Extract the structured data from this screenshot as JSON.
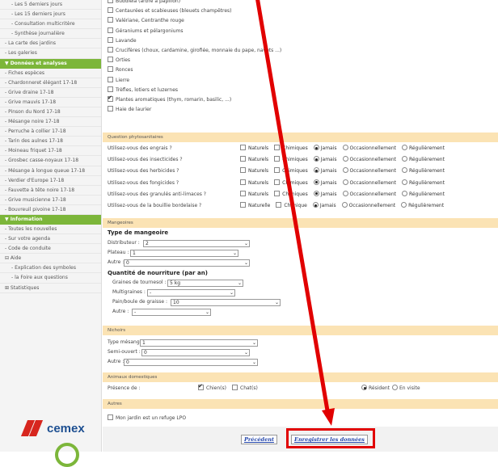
{
  "sidebar": {
    "items_top": [
      {
        "label": "- Les 5 derniers jours",
        "sub": true
      },
      {
        "label": "- Les 15 derniers jours",
        "sub": true
      },
      {
        "label": "- Consultation multicritère",
        "sub": true
      },
      {
        "label": "- Synthèse journalière",
        "sub": true
      },
      {
        "label": "- La carte des jardins",
        "sub": false
      },
      {
        "label": "- Les galeries",
        "sub": false
      }
    ],
    "section_donnees": "▼ Données et analyses",
    "items_donnees": [
      "- Fiches espèces",
      "- Chardonneret élégant 17-18",
      "- Grive draine 17-18",
      "- Grive mauvis 17-18",
      "- Pinson du Nord 17-18",
      "- Mésange noire 17-18",
      "- Perruche à collier 17-18",
      "- Tarin des aulnes 17-18",
      "- Moineau friquet 17-18",
      "- Grosbec casse-noyaux 17-18",
      "- Mésange à longue queue 17-18",
      "- Verdier d'Europe 17-18",
      "- Fauvette à tête noire 17-18",
      "- Grive musicienne 17-18",
      "- Bouvreuil pivoine 17-18"
    ],
    "section_information": "▼ Information",
    "items_information": [
      {
        "label": "- Toutes les nouvelles",
        "sub": false
      },
      {
        "label": "- Sur votre agenda",
        "sub": false
      },
      {
        "label": "- Code de conduite",
        "sub": false
      },
      {
        "label": "⊟ Aide",
        "sub": false
      },
      {
        "label": "- Explication des symboles",
        "sub": true
      },
      {
        "label": "- la Foire aux questions",
        "sub": true
      },
      {
        "label": "⊞ Statistiques",
        "sub": false
      }
    ],
    "logo_text": "cemex",
    "logo_colors": {
      "red": "#d7261e",
      "blue": "#1d4f91"
    }
  },
  "plants": [
    {
      "label": "Buddleia (arbre à papillon)",
      "checked": false
    },
    {
      "label": "Centaurées et scabieuses (bleuets champêtres)",
      "checked": false
    },
    {
      "label": "Valériane, Centranthe rouge",
      "checked": false
    },
    {
      "label": "Géraniums et pélargoniums",
      "checked": false
    },
    {
      "label": "Lavande",
      "checked": false
    },
    {
      "label": "Crucifères (choux, cardamine, girofiée, monnaie du pape, navets ...)",
      "checked": false
    },
    {
      "label": "Orties",
      "checked": false
    },
    {
      "label": "Ronces",
      "checked": false
    },
    {
      "label": "Lierre",
      "checked": false
    },
    {
      "label": "Trèfles, lotiers et luzernes",
      "checked": false
    },
    {
      "label": "Plantes aromatiques (thym, romarin, basilic, ...)",
      "checked": true
    },
    {
      "label": "Haie de laurier",
      "checked": false
    }
  ],
  "phyto": {
    "header": "Question phytosanitaires",
    "rows": [
      {
        "question": "Utilisez-vous des engrais ?",
        "opt1": "Naturels",
        "opt2": "Chimiques"
      },
      {
        "question": "Utilisez-vous des insecticides ?",
        "opt1": "Naturels",
        "opt2": "Chimiques"
      },
      {
        "question": "Utilisez-vous des herbicides ?",
        "opt1": "Naturels",
        "opt2": "Chimiques"
      },
      {
        "question": "Utilisez-vous des fongicides ?",
        "opt1": "Naturels",
        "opt2": "Chimiques"
      },
      {
        "question": "Utilisez-vous des granulés anti-limaces ?",
        "opt1": "Naturels",
        "opt2": "Chimiques"
      },
      {
        "question": "Utilisez-vous de la bouillie bordelaise ?",
        "opt1": "Naturelle",
        "opt2": "Chimique"
      }
    ],
    "freq": [
      "Jamais",
      "Occasionnellement",
      "Régulièrement"
    ],
    "selected": "Jamais"
  },
  "mangeoires": {
    "header": "Mangeoires",
    "type_title": "Type de mangeoire",
    "distributeur_label": "Distributeur :",
    "distributeur_value": "2",
    "plateau_label": "Plateau :",
    "plateau_value": "1",
    "autre_label": "Autre :",
    "autre_value": "0",
    "quantite_title": "Quantité de nourriture (par an)",
    "graines_label": "Graines de tournesol :",
    "graines_value": "5 kg",
    "multigraines_label": "Multigraines :",
    "multigraines_value": "-",
    "pain_label": "Pain/boule de graisse :",
    "pain_value": "10",
    "autre2_label": "Autre :",
    "autre2_value": "-"
  },
  "nichoirs": {
    "header": "Nichoirs",
    "mesange_label": "Type mésange :",
    "mesange_value": "1",
    "semi_label": "Semi-ouvert :",
    "semi_value": "0",
    "autre_label": "Autre :",
    "autre_value": "0"
  },
  "animaux": {
    "header": "Animaux domestiques",
    "presence_label": "Présence de :",
    "chiens": "Chien(s)",
    "chats": "Chat(s)",
    "resident": "Résident",
    "visite": "En visite"
  },
  "autres": {
    "header": "Autres",
    "refuge": "Mon jardin est un refuge LPO"
  },
  "buttons": {
    "previous": "Précédent",
    "save": "Enregistrer les données"
  },
  "colors": {
    "annotation": "#e10000",
    "section_bg": "#fbe3b4",
    "sidebar_green": "#7cb63a"
  }
}
